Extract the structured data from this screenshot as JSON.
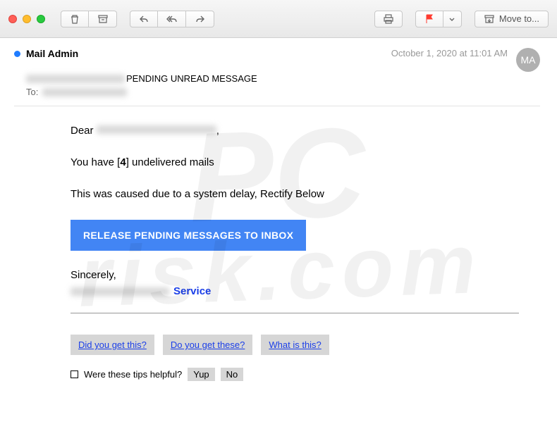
{
  "toolbar": {
    "move_label": "Move to..."
  },
  "header": {
    "from": "Mail Admin",
    "date": "October 1, 2020 at 11:01 AM",
    "avatar_initials": "MA",
    "subject": "PENDING UNREAD MESSAGE",
    "to_label": "To:"
  },
  "body": {
    "greeting_prefix": "Dear ",
    "greeting_suffix": ",",
    "line1_before": "You have [",
    "line1_count": "4",
    "line1_after": "] undelivered mails",
    "line2": "This was caused due to a system delay, Rectify Below",
    "cta": "RELEASE PENDING MESSAGES TO INBOX",
    "sincerely": "Sincerely,",
    "service": "Service"
  },
  "quickreply": {
    "q1": "Did you get this?",
    "q2": "Do you get these?",
    "q3": "What is this?"
  },
  "tips": {
    "prompt": "Were these tips helpful?",
    "yes": "Yup",
    "no": "No"
  },
  "watermark": {
    "line1": "PC",
    "line2": "risk.com"
  }
}
